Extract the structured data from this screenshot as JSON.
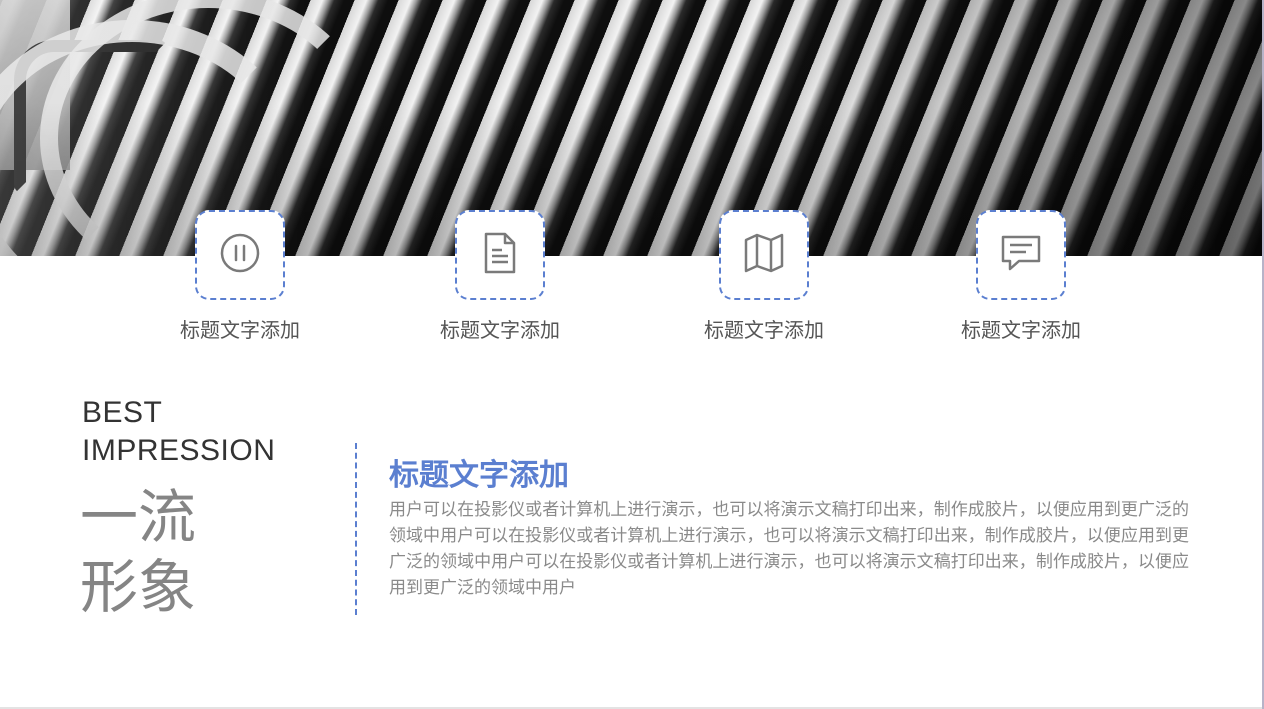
{
  "hero": {
    "icon": "architecture-photo"
  },
  "features": [
    {
      "label": "标题文字添加",
      "icon": "pause-circle-icon"
    },
    {
      "label": "标题文字添加",
      "icon": "document-icon"
    },
    {
      "label": "标题文字添加",
      "icon": "map-icon"
    },
    {
      "label": "标题文字添加",
      "icon": "chat-icon"
    }
  ],
  "headline": {
    "line1": "BEST",
    "line2": "IMPRESSION",
    "cn_line1": "一流",
    "cn_line2": "形象"
  },
  "content": {
    "title": "标题文字添加",
    "body": "用户可以在投影仪或者计算机上进行演示，也可以将演示文稿打印出来，制作成胶片，以便应用到更广泛的领域中用户可以在投影仪或者计算机上进行演示，也可以将演示文稿打印出来，制作成胶片，以便应用到更广泛的领域中用户可以在投影仪或者计算机上进行演示，也可以将演示文稿打印出来，制作成胶片，以便应用到更广泛的领域中用户"
  },
  "colors": {
    "accent": "#5b7fd0",
    "label": "#555555",
    "body": "#8a8a8a",
    "headline": "#333333",
    "cn_headline": "#858585"
  }
}
